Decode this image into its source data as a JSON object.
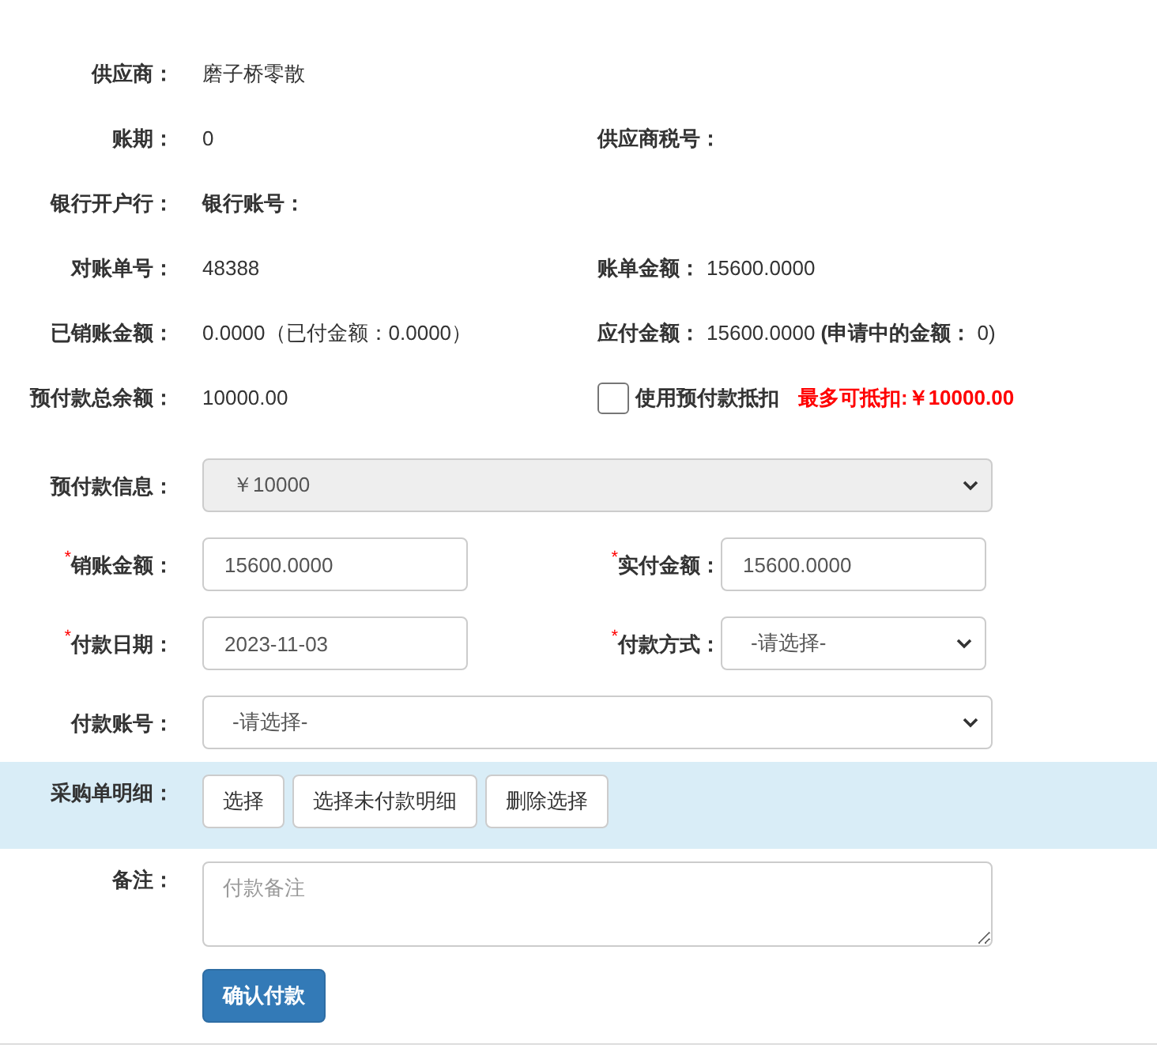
{
  "info_rows": [
    {
      "label": "供应商：",
      "content": [
        {
          "kind": "value",
          "text": "磨子桥零散"
        }
      ],
      "right": []
    },
    {
      "label": "账期：",
      "content": [
        {
          "kind": "value",
          "text": "0"
        }
      ],
      "right": [
        {
          "kind": "label",
          "text": "供应商税号："
        }
      ]
    },
    {
      "label": "银行开户行：",
      "content": [
        {
          "kind": "label",
          "text": "银行账号："
        }
      ],
      "right": []
    },
    {
      "label": "对账单号：",
      "content": [
        {
          "kind": "value",
          "text": "48388"
        }
      ],
      "right": [
        {
          "kind": "label",
          "text": "账单金额："
        },
        {
          "kind": "value",
          "text": "15600.0000"
        }
      ]
    },
    {
      "label": "已销账金额：",
      "content": [
        {
          "kind": "value",
          "text": "0.0000（已付金额：0.0000）"
        }
      ],
      "right": [
        {
          "kind": "label",
          "text": "应付金额："
        },
        {
          "kind": "value",
          "text": "15600.0000 **(申请中的金额：** 0)"
        }
      ]
    },
    {
      "label": "预付款总余额：",
      "content": [
        {
          "kind": "value",
          "text": "10000.00"
        }
      ],
      "right": [
        {
          "kind": "checkbox",
          "checked": false
        },
        {
          "kind": "label",
          "text": "使用预付款抵扣"
        },
        {
          "kind": "alert",
          "text": "最多可抵扣:￥10000.00"
        }
      ]
    }
  ],
  "form_rows": [
    {
      "fields": [
        {
          "label": "预付款信息：",
          "kind": "select",
          "value": "￥10000",
          "disabled": true
        }
      ]
    },
    {
      "fields": [
        {
          "required_mark": "*",
          "label": "销账金额：",
          "kind": "input",
          "value": "15600.0000",
          "disabled": false
        },
        {
          "required_mark": "*",
          "label": "实付金额：",
          "kind": "input",
          "value": "15600.0000",
          "disabled": false
        }
      ]
    },
    {
      "fields": [
        {
          "required_mark": "*",
          "label": "付款日期：",
          "kind": "input",
          "value": "2023-11-03",
          "disabled": false
        },
        {
          "required_mark": "*",
          "label": "付款方式：",
          "kind": "select",
          "value": "-请选择-",
          "disabled": false
        }
      ]
    },
    {
      "fields": [
        {
          "label": "付款账号：",
          "kind": "select",
          "value": "-请选择-",
          "disabled": false
        }
      ]
    }
  ],
  "detail_row": {
    "label": "采购单明细：",
    "buttons": [
      "选择",
      "选择未付款明细",
      "删除选择"
    ]
  },
  "remark": {
    "label": "备注：",
    "placeholder": "付款备注"
  },
  "submit": "确认付款"
}
